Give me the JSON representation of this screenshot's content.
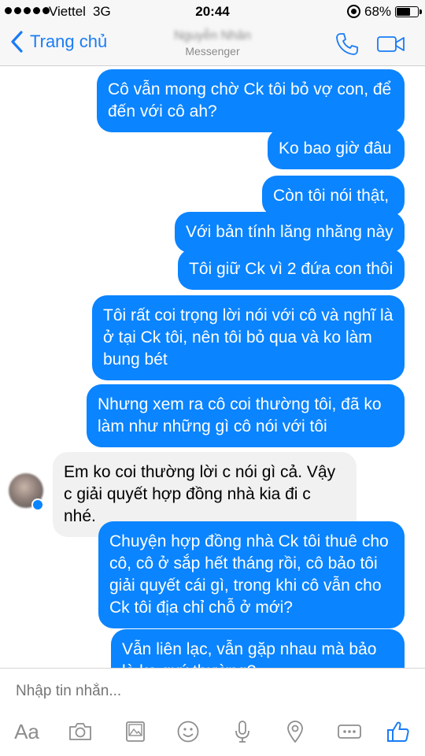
{
  "status_bar": {
    "carrier": "Viettel",
    "network": "3G",
    "time": "20:44",
    "battery": "68%",
    "battery_level": 0.68
  },
  "nav": {
    "back_label": "Trang chủ",
    "contact_name": "Nguyễn Nhân",
    "subtitle": "Messenger"
  },
  "messages": [
    {
      "dir": "out",
      "text": "Cô vẫn mong chờ Ck tôi bỏ vợ con, để đến với cô ah?"
    },
    {
      "dir": "out",
      "text": "Ko bao giờ đâu"
    },
    {
      "dir": "out",
      "text": "Còn tôi nói thật,"
    },
    {
      "dir": "out",
      "text": "Với bản tính lăng nhăng này"
    },
    {
      "dir": "out",
      "text": "Tôi giữ Ck vì 2 đứa con thôi"
    },
    {
      "dir": "out",
      "text": "Tôi rất coi trọng lời nói với cô và nghĩ là ở tại Ck tôi,  nên tôi bỏ qua và ko làm bung bét"
    },
    {
      "dir": "out",
      "text": "Nhưng xem ra cô coi thường tôi, đã ko làm như những gì cô nói với tôi"
    },
    {
      "dir": "in",
      "text": "Em ko coi thường lời c nói gì cả. Vậy c giải quyết hợp đồng nhà kia đi c nhé."
    },
    {
      "dir": "out",
      "text": "Chuyện hợp đồng nhà Ck tôi thuê cho cô, cô ở sắp hết tháng rồi, cô bảo tôi giải quyết cái gì, trong khi cô vẫn cho Ck tôi địa chỉ chỗ ở mới?"
    },
    {
      "dir": "out",
      "text": "Vẫn liên lạc, vẫn gặp nhau mà bảo là ko quý thường?"
    }
  ],
  "composer": {
    "placeholder": "Nhập tin nhắn...",
    "aa_label": "Aa"
  },
  "colors": {
    "accent": "#0a84ff",
    "incoming_bubble": "#f1f1f1"
  }
}
